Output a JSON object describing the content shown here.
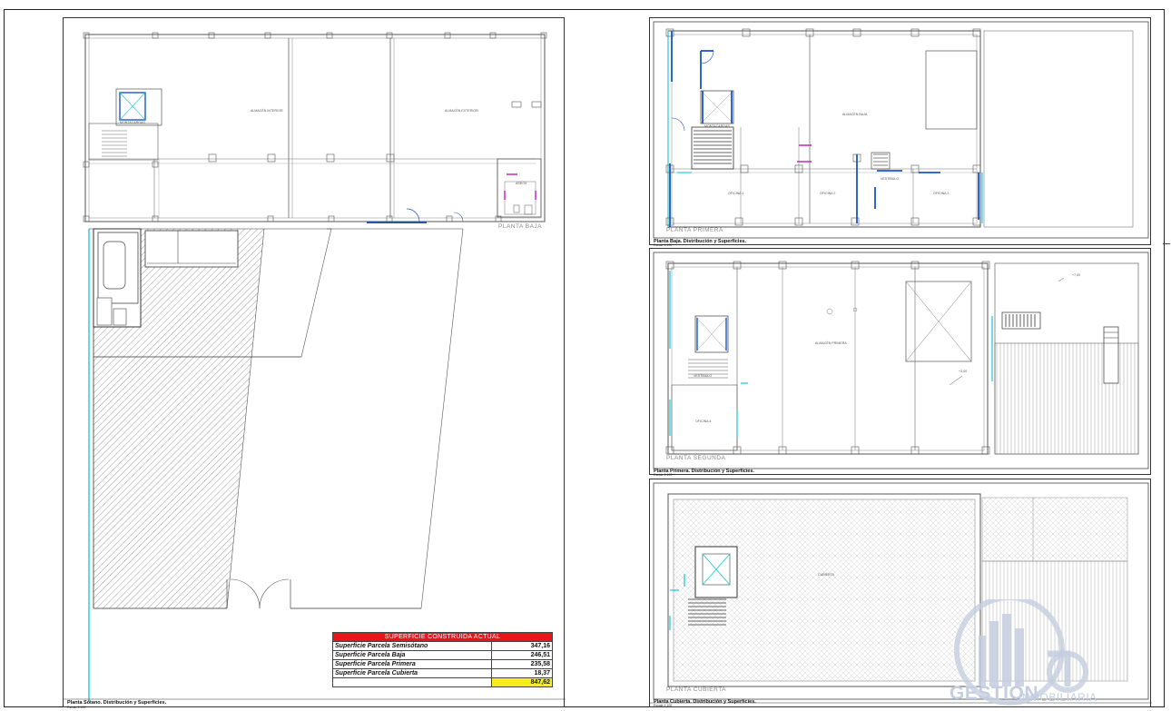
{
  "panels": {
    "sotano": {
      "caption": "Planta Sótano. Distribución y Superficies.",
      "scale": "Escala 1:100",
      "floor_label": "PLANTA BAJA",
      "rooms": [
        "ALMACÉN INTERIOR",
        "ALMACÉN EXTERIOR",
        "MONTACARGAS",
        "ASEOS"
      ]
    },
    "baja": {
      "caption": "Planta Baja. Distribución y Superficies.",
      "scale": "Escala 1:100",
      "floor_label": "PLANTA PRIMERA",
      "rooms": [
        "ALMACÉN BAJA",
        "MONTACARGAS",
        "OFICINA 1",
        "OFICINA 2",
        "VESTÍBULO",
        "OFICINA 3"
      ]
    },
    "primera": {
      "caption": "Planta Primera. Distribución y Superficies.",
      "scale": "Escala 1:100",
      "floor_label": "PLANTA SEGUNDA",
      "rooms": [
        "ALMACÉN PRIMERA",
        "OFICINA 4",
        "VESTÍBULO"
      ],
      "levels": [
        "+7,00",
        "+3,00"
      ]
    },
    "cubierta": {
      "caption": "Planta Cubierta. Distribución y Superficies.",
      "scale": "Escala 1:100",
      "floor_label": "PLANTA CUBIERTA",
      "rooms": [
        "CUBIERTA"
      ]
    }
  },
  "surface_table": {
    "title": "SUPERFICIE CONSTRUIDA ACTUAL",
    "rows": [
      {
        "label": "Superficie Parcela Semisótano",
        "value": "347,16"
      },
      {
        "label": "Superficie Parcela Baja",
        "value": "246,51"
      },
      {
        "label": "Superficie Parcela Primera",
        "value": "235,58"
      },
      {
        "label": "Superficie Parcela Cubierta",
        "value": "18,37"
      }
    ],
    "total": "847,62"
  },
  "watermark": {
    "brand": "GESTIÓN",
    "sub": "INMOBILIARIA"
  },
  "colors": {
    "table_header": "#e8151b",
    "table_total": "#f6ee1a",
    "door_blue": "#1a55c8",
    "glass_cyan": "#16c4d8",
    "door_magenta": "#c01ab8",
    "wall": "#555555",
    "watermark": "#c4cee0"
  }
}
